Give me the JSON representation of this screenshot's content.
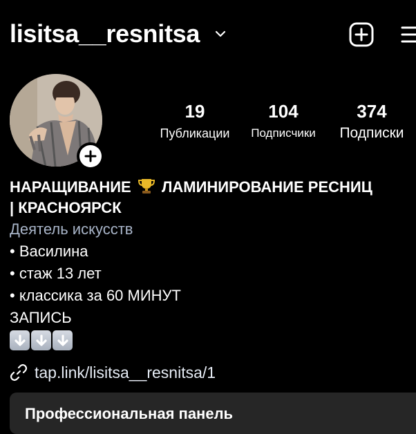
{
  "header": {
    "username": "lisitsa__resnitsa"
  },
  "stats": {
    "posts": {
      "value": "19",
      "label": "Публикации"
    },
    "followers": {
      "value": "104",
      "label": "Подписчики"
    },
    "following": {
      "value": "374",
      "label": "Подписки"
    }
  },
  "bio": {
    "name_part1": "НАРАЩИВАНИЕ",
    "name_part2": "ЛАМИНИРОВАНИЕ РЕСНИЦ",
    "name_line2": "| КРАСНОЯРСК",
    "category": "Деятель искусств",
    "lines": [
      "• Василина",
      "• стаж 13 лет",
      "• классика за 60 МИНУТ"
    ],
    "cta": "ЗАПИСЬ"
  },
  "link": {
    "text": "tap.link/lisitsa__resnitsa/1"
  },
  "pro_panel": {
    "label": "Профессиональная панель"
  },
  "icons": {
    "chevron": "chevron-down-icon",
    "add": "add-post-icon",
    "menu": "menu-icon",
    "trophy": "trophy-emoji",
    "arrow": "down-arrow-emoji",
    "link": "link-icon"
  }
}
